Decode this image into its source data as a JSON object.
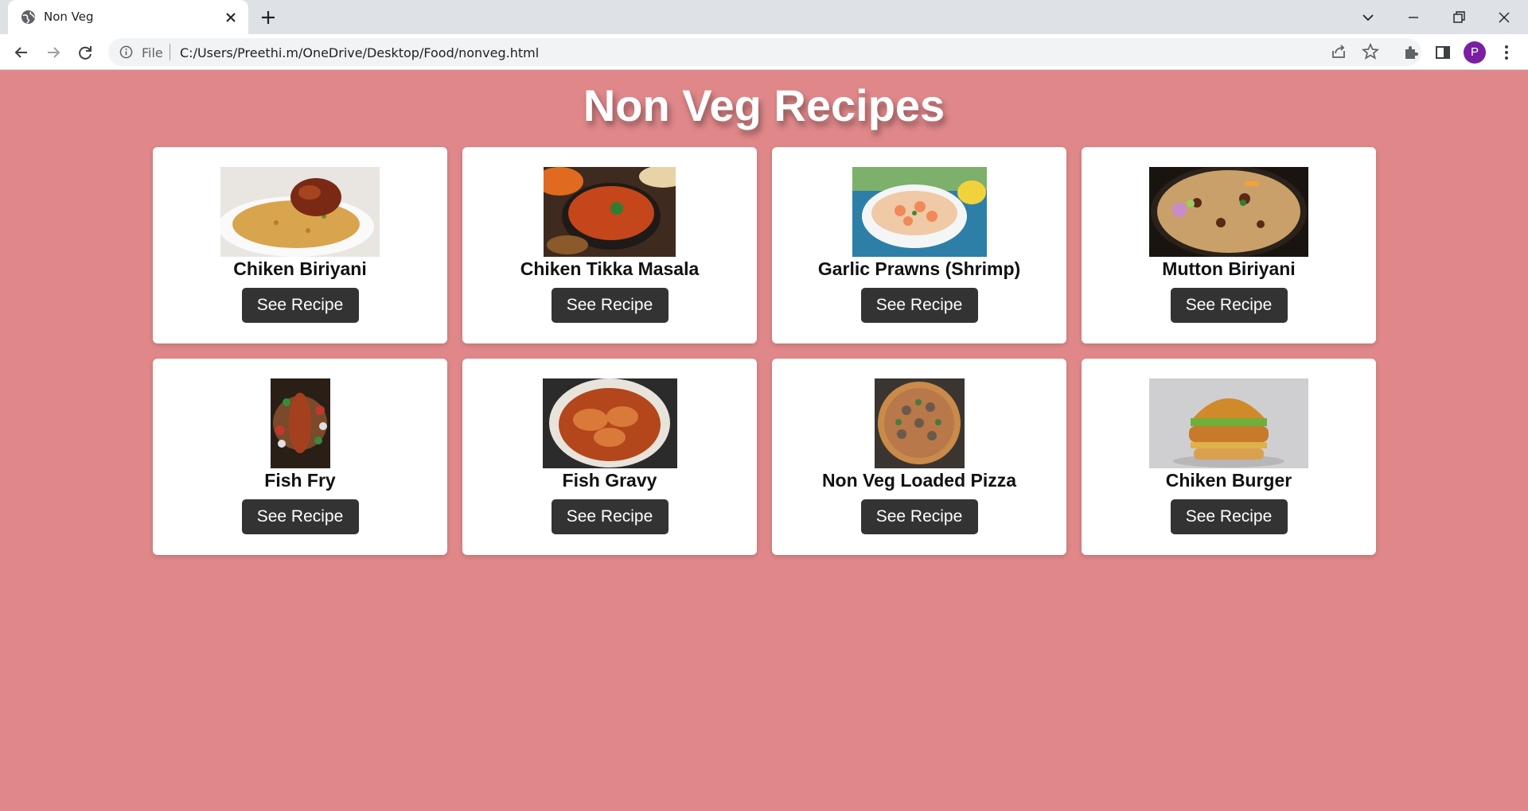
{
  "browser": {
    "tab_title": "Non Veg",
    "scheme_label": "File",
    "url": "C:/Users/Preethi.m/OneDrive/Desktop/Food/nonveg.html",
    "profile_initial": "P"
  },
  "page": {
    "title": "Non Veg Recipes",
    "background": "#df8789",
    "button_color": "#333333",
    "recipes": [
      {
        "name": "Chiken Biriyani",
        "button": "See Recipe"
      },
      {
        "name": "Chiken Tikka Masala",
        "button": "See Recipe"
      },
      {
        "name": "Garlic Prawns (Shrimp)",
        "button": "See Recipe"
      },
      {
        "name": "Mutton Biriyani",
        "button": "See Recipe"
      },
      {
        "name": "Fish Fry",
        "button": "See Recipe"
      },
      {
        "name": "Fish Gravy",
        "button": "See Recipe"
      },
      {
        "name": "Non Veg Loaded Pizza",
        "button": "See Recipe"
      },
      {
        "name": "Chiken Burger",
        "button": "See Recipe"
      }
    ]
  }
}
